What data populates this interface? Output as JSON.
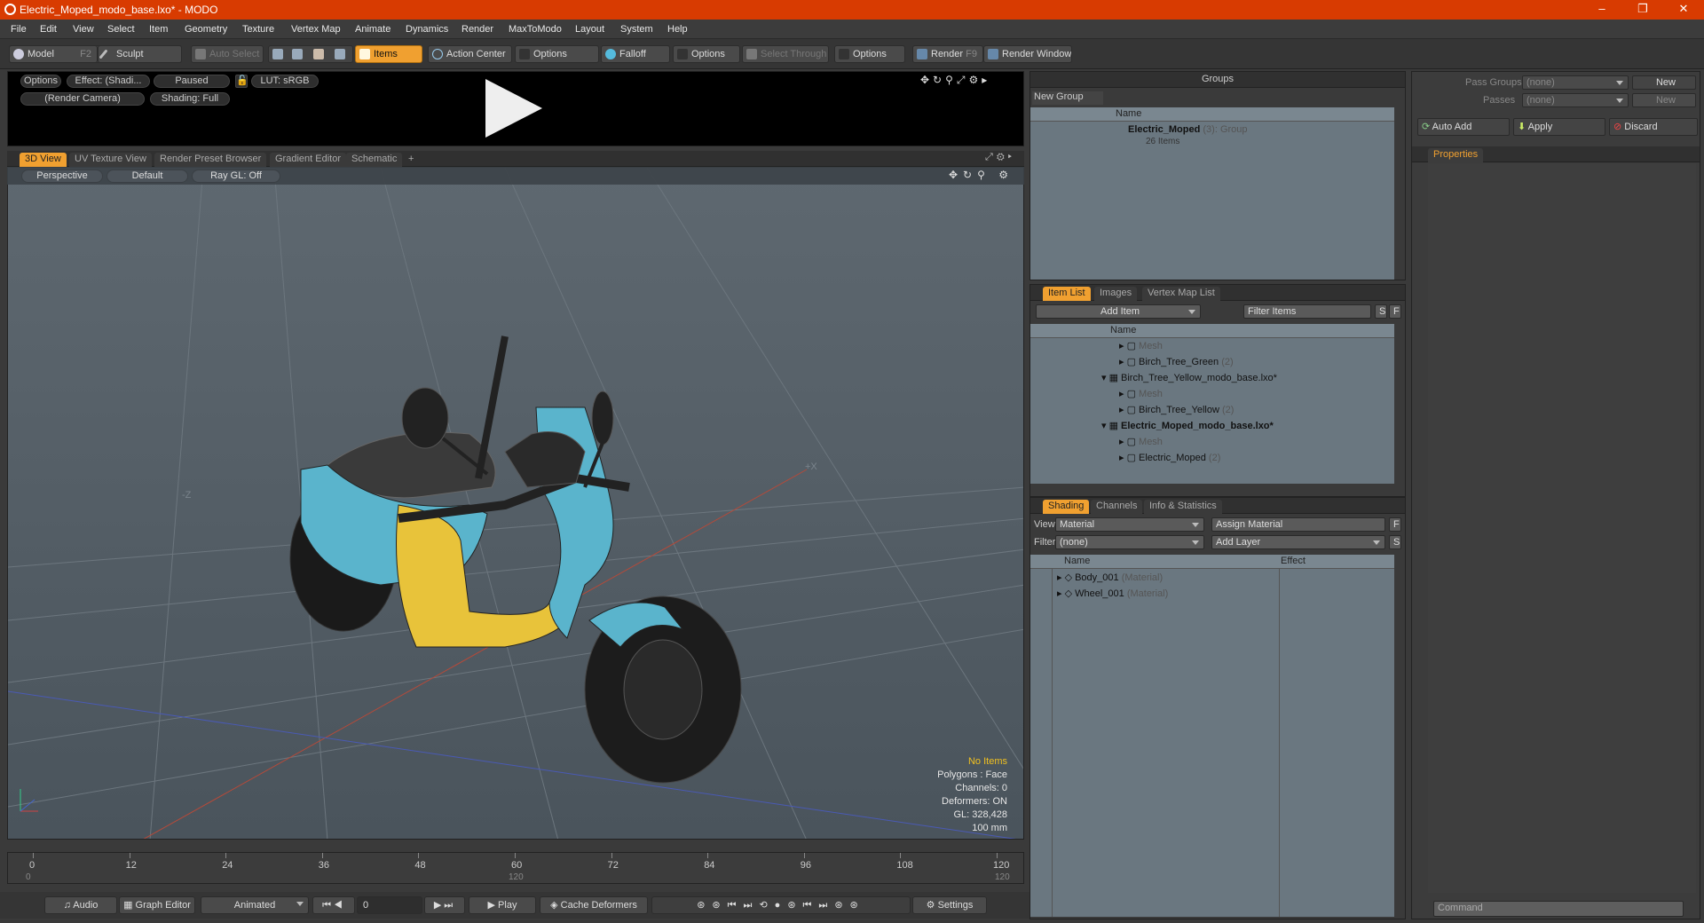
{
  "window": {
    "title": "Electric_Moped_modo_base.lxo* - MODO"
  },
  "menu": [
    "File",
    "Edit",
    "View",
    "Select",
    "Item",
    "Geometry",
    "Texture",
    "Vertex Map",
    "Animate",
    "Dynamics",
    "Render",
    "MaxToModo",
    "Layout",
    "System",
    "Help"
  ],
  "toolbar": {
    "model": "Model",
    "model_key": "F2",
    "sculpt": "Sculpt",
    "auto_select": "Auto Select",
    "items": "Items",
    "action_center": "Action Center",
    "options1": "Options",
    "falloff": "Falloff",
    "options2": "Options",
    "select_through": "Select Through",
    "options3": "Options",
    "render": "Render",
    "render_key": "F9",
    "render_window": "Render Window"
  },
  "preview": {
    "options": "Options",
    "effect": "Effect: (Shadi...",
    "paused": "Paused",
    "lut": "LUT: sRGB",
    "camera": "(Render Camera)",
    "shading": "Shading: Full"
  },
  "view_tabs": [
    "3D View",
    "UV Texture View",
    "Render Preset Browser",
    "Gradient Editor",
    "Schematic"
  ],
  "viewport": {
    "perspective": "Perspective",
    "default": "Default",
    "raygl": "Ray GL: Off",
    "axis_x": "+X",
    "axis_z": "-Z",
    "stats": [
      "No Items",
      "Polygons : Face",
      "Channels: 0",
      "Deformers: ON",
      "GL: 328,428",
      "100 mm"
    ]
  },
  "timeline": {
    "ticks": [
      "0",
      "12",
      "24",
      "36",
      "48",
      "60",
      "72",
      "84",
      "96",
      "108",
      "120"
    ],
    "start": "0",
    "mid": "120",
    "end": "120"
  },
  "bottom": {
    "audio": "Audio",
    "graph_editor": "Graph Editor",
    "animated": "Animated",
    "frame": "0",
    "play": "Play",
    "cache": "Cache Deformers",
    "settings": "Settings"
  },
  "groups": {
    "title": "Groups",
    "new_group": "New Group",
    "col_name": "Name",
    "item_name": "Electric_Moped",
    "item_count": "(3)",
    "item_type": ": Group",
    "items_text": "26 Items"
  },
  "itemlist": {
    "tabs": [
      "Item List",
      "Images",
      "Vertex Map List"
    ],
    "add_item": "Add Item",
    "filter": "Filter Items",
    "s": "S",
    "f": "F",
    "col_name": "Name",
    "rows": [
      {
        "text": "Mesh",
        "dim": true,
        "indent": 2
      },
      {
        "text": "Birch_Tree_Green",
        "suffix": "(2)",
        "indent": 2
      },
      {
        "text": "Birch_Tree_Yellow_modo_base.lxo*",
        "indent": 1
      },
      {
        "text": "Mesh",
        "dim": true,
        "indent": 2
      },
      {
        "text": "Birch_Tree_Yellow",
        "suffix": "(2)",
        "indent": 2
      },
      {
        "text": "Electric_Moped_modo_base.lxo*",
        "bold": true,
        "indent": 1
      },
      {
        "text": "Mesh",
        "dim": true,
        "indent": 2
      },
      {
        "text": "Electric_Moped",
        "suffix": "(2)",
        "indent": 2
      }
    ]
  },
  "shading": {
    "tabs": [
      "Shading",
      "Channels",
      "Info & Statistics"
    ],
    "view_label": "View",
    "view_value": "Material",
    "assign": "Assign Material",
    "f": "F",
    "filter_label": "Filter",
    "filter_value": "(none)",
    "add_layer": "Add Layer",
    "s": "S",
    "col_name": "Name",
    "col_effect": "Effect",
    "rows": [
      {
        "name": "Body_001",
        "type": "(Material)"
      },
      {
        "name": "Wheel_001",
        "type": "(Material)"
      }
    ]
  },
  "right": {
    "pass_groups": "Pass Groups",
    "pass_value": "(none)",
    "new1": "New",
    "passes": "Passes",
    "passes_value": "(none)",
    "new2": "New",
    "auto_add": "Auto Add",
    "apply": "Apply",
    "discard": "Discard",
    "properties": "Properties",
    "command": "Command"
  },
  "colors": {
    "accent": "#f0a030",
    "titlebar": "#d83b01"
  }
}
